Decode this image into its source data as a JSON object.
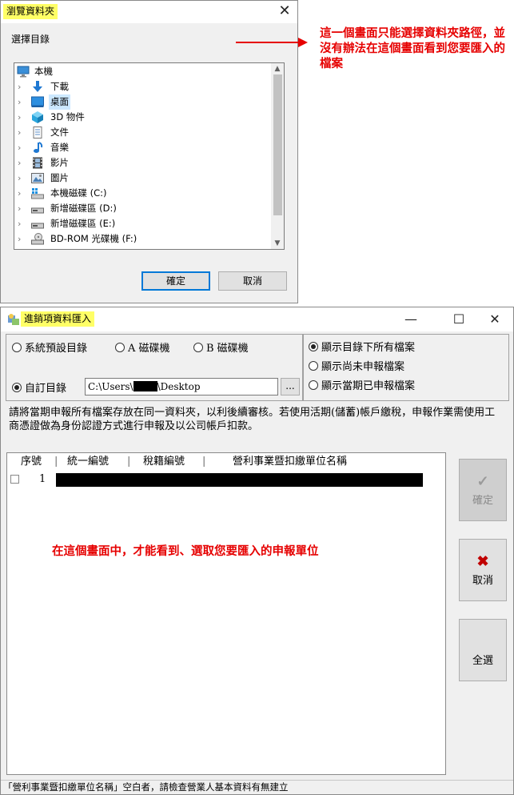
{
  "browse_dialog": {
    "title": "瀏覽資料夾",
    "prompt": "選擇目錄",
    "tree_items": [
      {
        "label": "本機",
        "icon": "computer-icon",
        "expandable": false,
        "indent": 0
      },
      {
        "label": "下載",
        "icon": "download-arrow-icon",
        "expandable": true,
        "indent": 1
      },
      {
        "label": "桌面",
        "icon": "desktop-icon",
        "expandable": true,
        "indent": 1,
        "selected": true
      },
      {
        "label": "3D 物件",
        "icon": "3d-objects-icon",
        "expandable": true,
        "indent": 1
      },
      {
        "label": "文件",
        "icon": "documents-icon",
        "expandable": true,
        "indent": 1
      },
      {
        "label": "音樂",
        "icon": "music-note-icon",
        "expandable": true,
        "indent": 1
      },
      {
        "label": "影片",
        "icon": "film-icon",
        "expandable": true,
        "indent": 1
      },
      {
        "label": "圖片",
        "icon": "pictures-icon",
        "expandable": true,
        "indent": 1
      },
      {
        "label": "本機磁碟 (C:)",
        "icon": "windows-drive-icon",
        "expandable": true,
        "indent": 1
      },
      {
        "label": "新增磁碟區 (D:)",
        "icon": "drive-icon",
        "expandable": true,
        "indent": 1
      },
      {
        "label": "新增磁碟區 (E:)",
        "icon": "drive-icon",
        "expandable": true,
        "indent": 1
      },
      {
        "label": "BD-ROM 光碟機 (F:)",
        "icon": "disc-drive-icon",
        "expandable": true,
        "indent": 1
      }
    ],
    "ok_label": "確定",
    "cancel_label": "取消",
    "close_glyph": "✕"
  },
  "annotation_top": "這一個畫面只能選擇資料夾路徑，並沒有辦法在這個畫面看到您要匯入的檔案",
  "import_window": {
    "title": "進銷項資料匯入",
    "controls": {
      "minimize": "—",
      "maximize": "☐",
      "close": "✕"
    },
    "source_options": [
      {
        "label": "系統預設目錄",
        "checked": false
      },
      {
        "label": "A 磁碟機",
        "checked": false
      },
      {
        "label": "B 磁碟機",
        "checked": false
      },
      {
        "label": "自訂目錄",
        "checked": true
      }
    ],
    "path_prefix": "C:\\Users\\",
    "path_suffix": "\\Desktop",
    "browse_label": "...",
    "filter_options": [
      {
        "label": "顯示目錄下所有檔案",
        "checked": true
      },
      {
        "label": "顯示尚未申報檔案",
        "checked": false
      },
      {
        "label": "顯示當期已申報檔案",
        "checked": false
      }
    ],
    "description": "請將當期申報所有檔案存放在同一資料夾，以利後續審核。若使用活期(儲蓄)帳戶繳稅，申報作業需使用工商憑證做為身份認證方式進行申報及以公司帳戶扣款。",
    "columns": [
      "序號",
      "統一編號",
      "稅籍編號",
      "營利事業暨扣繳單位名稱"
    ],
    "rows": [
      {
        "index": "1",
        "checked": false
      }
    ],
    "side_buttons": {
      "confirm": {
        "label": "確定",
        "icon": "checkmark-icon",
        "enabled": false
      },
      "cancel": {
        "label": "取消",
        "icon": "red-x-icon",
        "enabled": true
      },
      "select_all": {
        "label": "全選",
        "enabled": true
      }
    },
    "status_text": "「營利事業暨扣繳單位名稱」空白者，請檢查營業人基本資料有無建立"
  },
  "annotation_bottom": "在這個畫面中，才能看到、選取您要匯入的申報單位",
  "colors": {
    "annotation": "#e60000",
    "title_highlight": "#ffff66",
    "selection": "#cce8ff",
    "cancel_x": "#c00000"
  }
}
